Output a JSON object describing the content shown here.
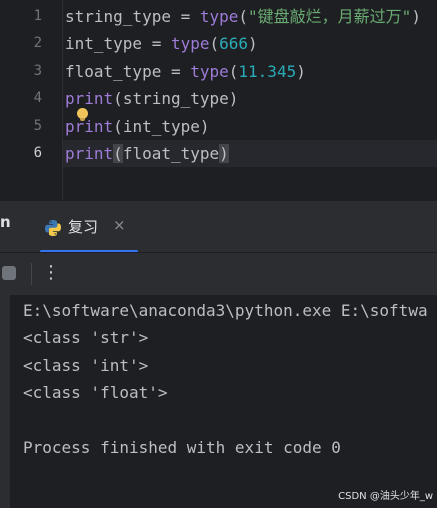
{
  "editor": {
    "line_numbers": [
      "1",
      "2",
      "3",
      "4",
      "5",
      "6"
    ],
    "lines": [
      {
        "var": "string_type",
        "op": " = ",
        "fn": "type",
        "open": "(",
        "str": "\"键盘敲烂，月薪过万\"",
        "close": ")"
      },
      {
        "var": "int_type",
        "op": " = ",
        "fn": "type",
        "open": "(",
        "num": "666",
        "close": ")"
      },
      {
        "var": "float_type",
        "op": " = ",
        "fn": "type",
        "open": "(",
        "num": "11.345",
        "close": ")"
      },
      {
        "fn": "print",
        "open": "(",
        "arg": "string_type",
        "close": ")"
      },
      {
        "fn": "print",
        "open": "(",
        "arg": "int_type",
        "close": ")"
      },
      {
        "fn": "print",
        "open": "(",
        "arg": "float_type",
        "close": ")"
      }
    ],
    "active_line": 6
  },
  "run_panel": {
    "left_tab_stub": "n",
    "tab_label": "复习",
    "tab_close": "×",
    "more_glyph": "⋮",
    "icons": [
      "python-icon",
      "stop-icon",
      "more-vertical-icon",
      "intention-bulb-icon"
    ]
  },
  "console": {
    "lines": [
      "E:\\software\\anaconda3\\python.exe E:\\softwa",
      "<class 'str'>",
      "<class 'int'>",
      "<class 'float'>",
      "",
      "Process finished with exit code 0"
    ]
  },
  "watermark": "CSDN @油头少年_w",
  "colors": {
    "editor_bg": "#1e1f22",
    "panel_bg": "#2b2d30",
    "keyword_fn": "#9d7cd8",
    "string": "#6aab73",
    "number": "#2aacb8",
    "tab_accent": "#3574f0"
  }
}
